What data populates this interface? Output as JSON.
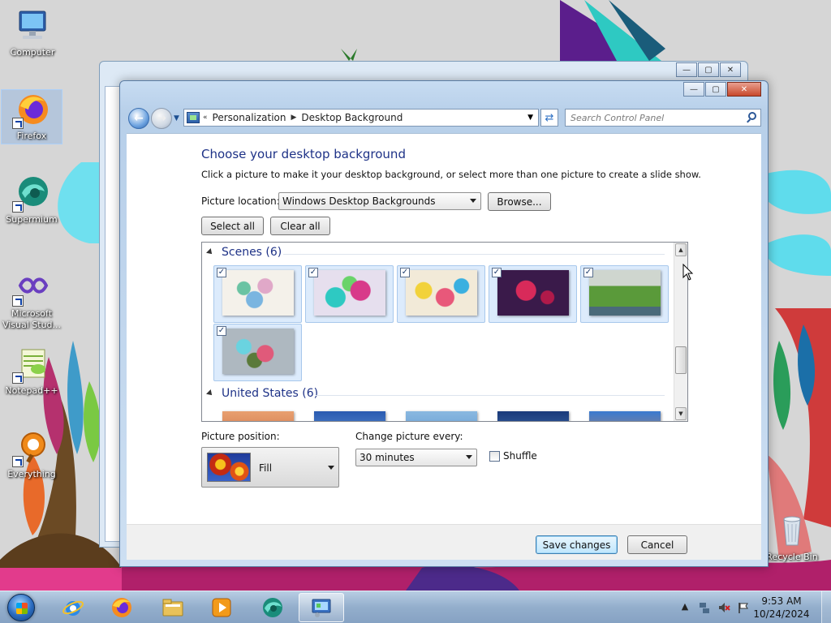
{
  "desktop": {
    "icons": [
      {
        "label": "Computer",
        "icon": "computer-icon"
      },
      {
        "label": "Firefox",
        "icon": "firefox-icon"
      },
      {
        "label": "Supermium",
        "icon": "supermium-icon"
      },
      {
        "label": "Microsoft Visual Stud...",
        "icon": "visual-studio-icon"
      },
      {
        "label": "Notepad++",
        "icon": "notepadpp-icon"
      },
      {
        "label": "Everything",
        "icon": "everything-icon"
      },
      {
        "label": "Recycle Bin",
        "icon": "recycle-bin-icon"
      }
    ]
  },
  "window": {
    "breadcrumb": [
      "Personalization",
      "Desktop Background"
    ],
    "search_placeholder": "Search Control Panel",
    "title": "Choose your desktop background",
    "description": "Click a picture to make it your desktop background, or select more than one picture to create a slide show.",
    "picture_location_label": "Picture location:",
    "picture_location_value": "Windows Desktop Backgrounds",
    "browse_label": "Browse...",
    "select_all_label": "Select all",
    "clear_all_label": "Clear all",
    "groups": [
      {
        "title": "Scenes (6)",
        "count_checked": 6
      },
      {
        "title": "United States (6)"
      }
    ],
    "picture_position_label": "Picture position:",
    "picture_position_value": "Fill",
    "change_every_label": "Change picture every:",
    "change_every_value": "30 minutes",
    "shuffle_label": "Shuffle",
    "shuffle_checked": false,
    "save_label": "Save changes",
    "cancel_label": "Cancel"
  },
  "taskbar": {
    "pinned": [
      "internet-explorer-icon",
      "firefox-icon",
      "file-explorer-icon",
      "media-player-icon",
      "supermium-icon",
      "control-panel-icon"
    ],
    "time": "9:53 AM",
    "date": "10/24/2024"
  },
  "colors": {
    "accent": "#1e3287",
    "title_bar": "#b7cfe9",
    "taskbar": "#93aecc"
  }
}
